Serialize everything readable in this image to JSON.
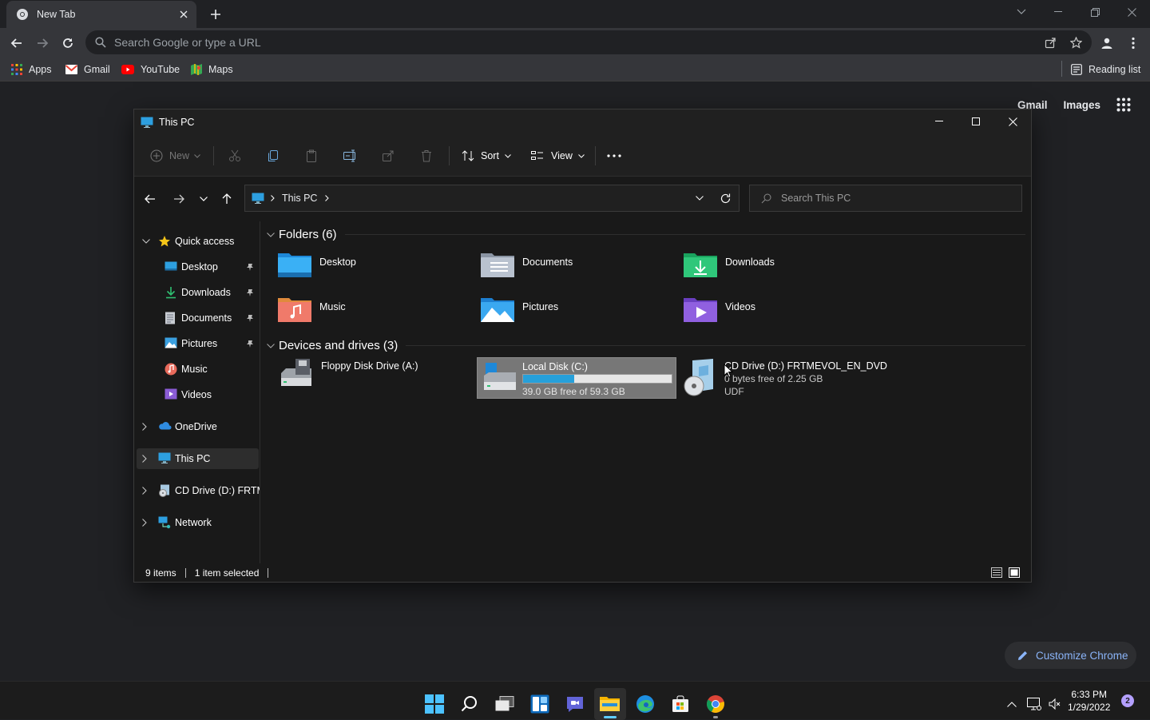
{
  "browser": {
    "tab_title": "New Tab",
    "omnibox_placeholder": "Search Google or type a URL",
    "bookmarks": [
      {
        "label": "Apps",
        "icon": "apps-grid-icon"
      },
      {
        "label": "Gmail",
        "icon": "gmail-icon"
      },
      {
        "label": "YouTube",
        "icon": "youtube-icon"
      },
      {
        "label": "Maps",
        "icon": "maps-icon"
      }
    ],
    "reading_list": "Reading list"
  },
  "ntp": {
    "gmail_link": "Gmail",
    "images_link": "Images",
    "customize_label": "Customize Chrome"
  },
  "explorer": {
    "window_title": "This PC",
    "command_bar": {
      "new_label": "New",
      "sort_label": "Sort",
      "view_label": "View",
      "more_label": "..."
    },
    "address": {
      "segment": "This PC"
    },
    "search_placeholder": "Search This PC",
    "nav": {
      "quick_access": "Quick access",
      "items": [
        {
          "label": "Desktop",
          "pinned": true
        },
        {
          "label": "Downloads",
          "pinned": true
        },
        {
          "label": "Documents",
          "pinned": true
        },
        {
          "label": "Pictures",
          "pinned": true
        },
        {
          "label": "Music",
          "pinned": false
        },
        {
          "label": "Videos",
          "pinned": false
        }
      ],
      "onedrive": "OneDrive",
      "this_pc": "This PC",
      "cd_drive": "CD Drive (D:) FRTMEVOL_EN_DVD",
      "network": "Network"
    },
    "folders_header": "Folders (6)",
    "folders": [
      {
        "label": "Desktop"
      },
      {
        "label": "Documents"
      },
      {
        "label": "Downloads"
      },
      {
        "label": "Music"
      },
      {
        "label": "Pictures"
      },
      {
        "label": "Videos"
      }
    ],
    "devices_header": "Devices and drives (3)",
    "drives": {
      "floppy": {
        "name": "Floppy Disk Drive (A:)"
      },
      "local": {
        "name": "Local Disk (C:)",
        "free_text": "39.0 GB free of 59.3 GB",
        "used_fraction": 0.342
      },
      "cd": {
        "name": "CD Drive (D:) FRTMEVOL_EN_DVD",
        "free_text": "0 bytes free of 2.25 GB",
        "fs": "UDF"
      }
    },
    "status": {
      "items": "9 items",
      "selected": "1 item selected"
    }
  },
  "taskbar": {
    "time": "6:33 PM",
    "date": "1/29/2022",
    "notifications": "2"
  }
}
